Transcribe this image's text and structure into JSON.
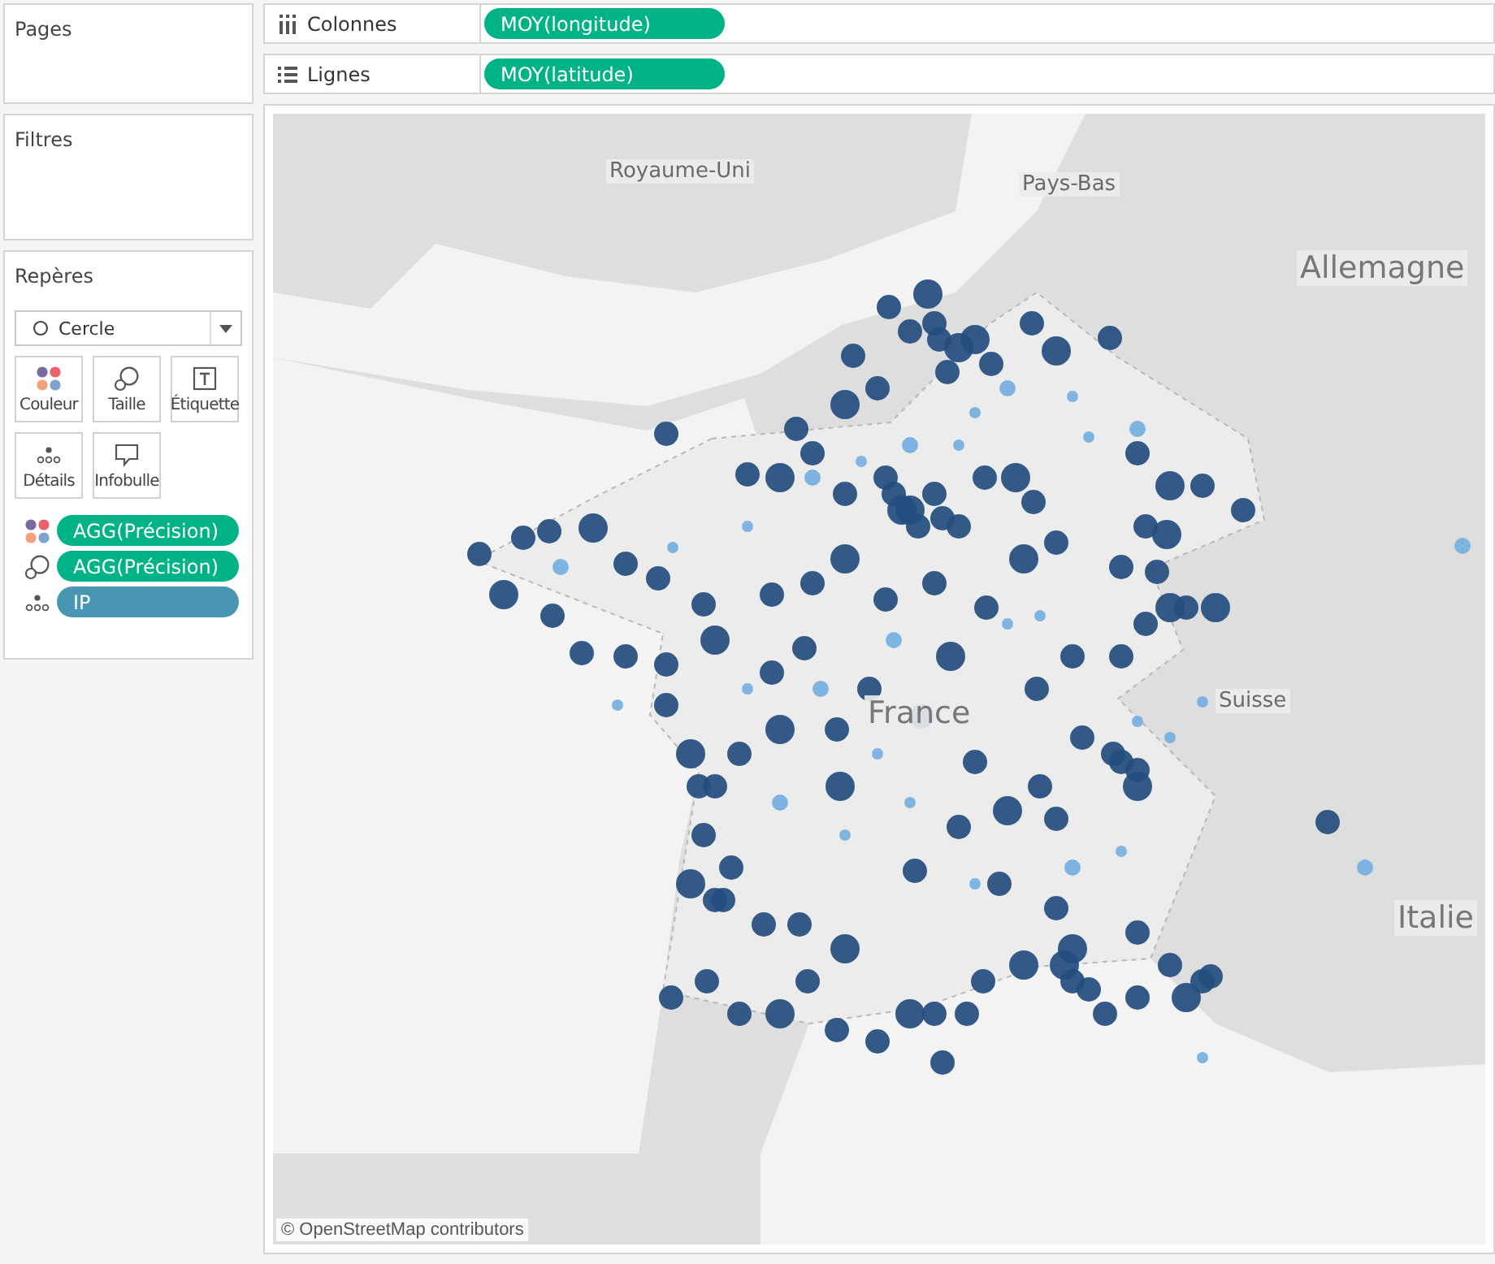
{
  "side": {
    "pages": {
      "title": "Pages"
    },
    "filters": {
      "title": "Filtres"
    },
    "marks": {
      "title": "Repères",
      "mark_type": "Cercle",
      "buttons": [
        {
          "kind": "color",
          "label": "Couleur"
        },
        {
          "kind": "size",
          "label": "Taille"
        },
        {
          "kind": "label",
          "label": "Étiquette"
        },
        {
          "kind": "detail",
          "label": "Détails"
        },
        {
          "kind": "tooltip",
          "label": "Infobulle"
        }
      ],
      "fields": [
        {
          "kind": "color",
          "label": "AGG(Précision)",
          "color": "#00b386"
        },
        {
          "kind": "size",
          "label": "AGG(Précision)",
          "color": "#00b386"
        },
        {
          "kind": "detail",
          "label": "IP",
          "color": "#4996b2"
        }
      ]
    }
  },
  "shelves": [
    {
      "kind": "columns",
      "label": "Colonnes",
      "pills": [
        {
          "label": "MOY(longitude)",
          "color": "#00b386"
        }
      ]
    },
    {
      "kind": "rows",
      "label": "Lignes",
      "pills": [
        {
          "label": "MOY(latitude)",
          "color": "#00b386"
        }
      ]
    }
  ],
  "map": {
    "labels": [
      {
        "text": "Royaume-Uni",
        "kind": "country"
      },
      {
        "text": "Pays-Bas",
        "kind": "country"
      },
      {
        "text": "Allemagne",
        "kind": "major"
      },
      {
        "text": "France",
        "kind": "major"
      },
      {
        "text": "Suisse",
        "kind": "country"
      },
      {
        "text": "Italie",
        "kind": "major"
      }
    ],
    "attribution": "© OpenStreetMap contributors"
  }
}
